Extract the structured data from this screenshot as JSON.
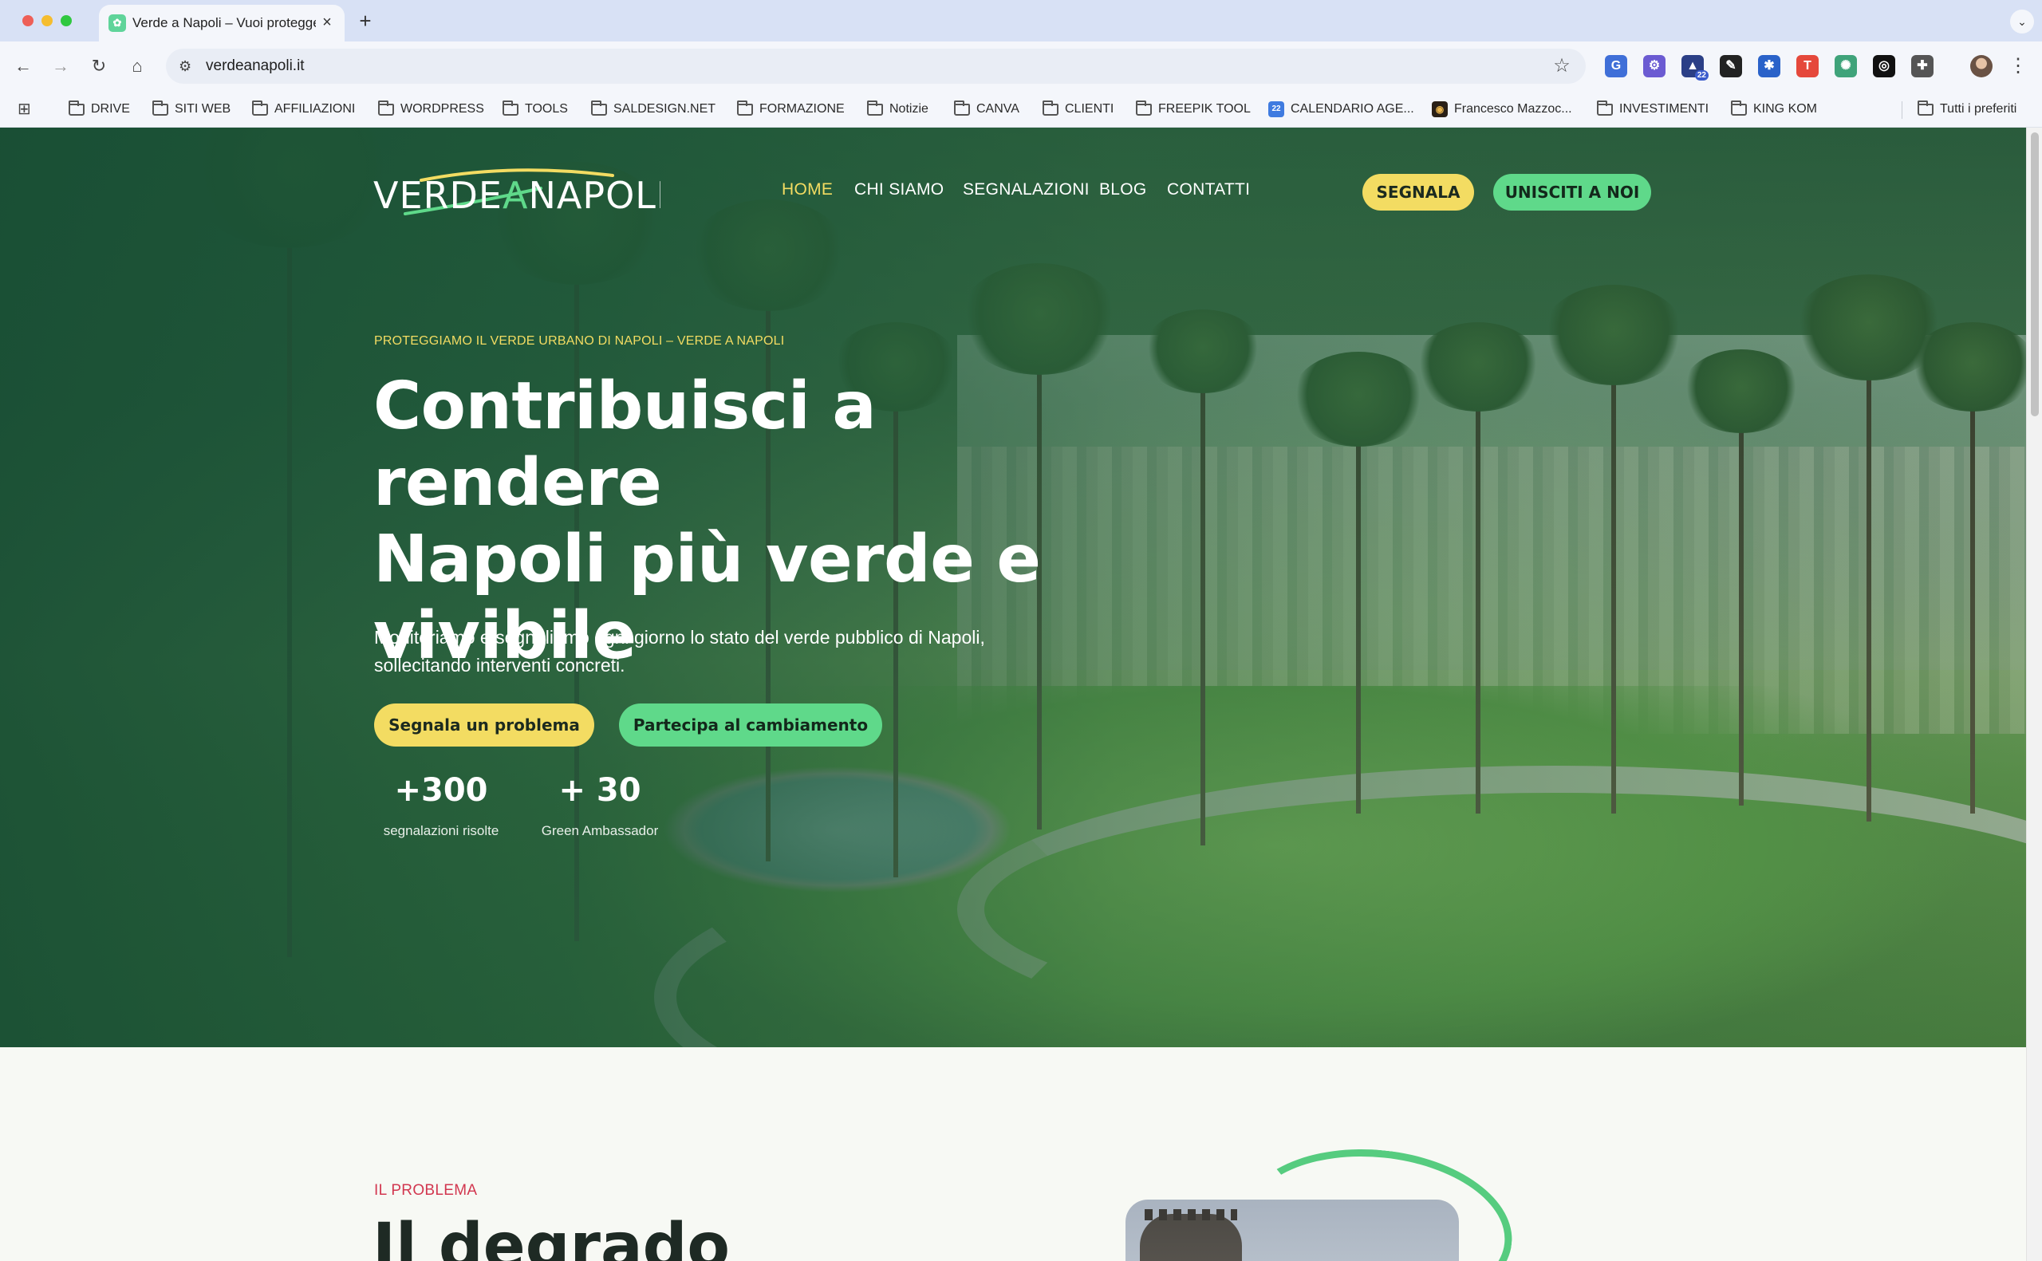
{
  "browser": {
    "tab": {
      "title": "Verde a Napoli – Vuoi proteggere",
      "favicon": "leaf-icon"
    },
    "url": "verdeanapoli.it",
    "extensions": [
      {
        "name": "translate-icon",
        "color": "#3f6fd8",
        "glyph": "G"
      },
      {
        "name": "extension-gear-icon",
        "color": "#6b5bd2",
        "glyph": "⚙"
      },
      {
        "name": "grad-cap-icon",
        "color": "#2b3f86",
        "glyph": "▲",
        "badge": "22"
      },
      {
        "name": "eyedropper-icon",
        "color": "#222222",
        "glyph": "✎"
      },
      {
        "name": "extension-blue-icon",
        "color": "#2a62c9",
        "glyph": "✱"
      },
      {
        "name": "t-extension-icon",
        "color": "#e5483b",
        "glyph": "T"
      },
      {
        "name": "chatgpt-icon",
        "color": "#3fa37a",
        "glyph": "✺"
      },
      {
        "name": "openai-icon",
        "color": "#111111",
        "glyph": "◎"
      },
      {
        "name": "puzzle-icon",
        "color": "#555555",
        "glyph": "✚"
      }
    ],
    "bookmarks": [
      {
        "label": "DRIVE",
        "type": "folder"
      },
      {
        "label": "SITI WEB",
        "type": "folder"
      },
      {
        "label": "AFFILIAZIONI",
        "type": "folder"
      },
      {
        "label": "WORDPRESS",
        "type": "folder"
      },
      {
        "label": "TOOLS",
        "type": "folder"
      },
      {
        "label": "SALDESIGN.NET",
        "type": "folder"
      },
      {
        "label": "FORMAZIONE",
        "type": "folder"
      },
      {
        "label": "Notizie",
        "type": "folder"
      },
      {
        "label": "CANVA",
        "type": "folder"
      },
      {
        "label": "CLIENTI",
        "type": "folder"
      },
      {
        "label": "FREEPIK TOOL",
        "type": "folder"
      },
      {
        "label": "CALENDARIO AGE...",
        "type": "calendar"
      },
      {
        "label": "Francesco Mazzoc...",
        "type": "site"
      },
      {
        "label": "INVESTIMENTI",
        "type": "folder"
      },
      {
        "label": "KING KOM",
        "type": "folder"
      }
    ],
    "bookmarks_other": "Tutti i preferiti"
  },
  "site": {
    "logo": {
      "left": "VERDE",
      "mid": "A",
      "right": "NAPOLI"
    },
    "nav": [
      "HOME",
      "CHI SIAMO",
      "SEGNALAZIONI",
      "BLOG",
      "CONTATTI"
    ],
    "nav_active": "HOME",
    "btn_segnala": "SEGNALA",
    "btn_unisciti": "UNISCITI A NOI",
    "accent_yellow": "#f3dc62",
    "accent_green": "#5fd98a"
  },
  "hero": {
    "eyebrow": "PROTEGGIAMO IL VERDE URBANO DI NAPOLI – VERDE A NAPOLI",
    "headline_line1": "Contribuisci a rendere",
    "headline_line2": "Napoli più verde e",
    "headline_line3": "vivibile",
    "subtitle_line1": "Monitoriamo e segnaliamo ogni giorno lo stato del verde pubblico di Napoli,",
    "subtitle_line2": "sollecitando interventi concreti.",
    "cta_primary": "Segnala un problema",
    "cta_secondary": "Partecipa al cambiamento",
    "stats": [
      {
        "value": "+300",
        "label": "segnalazioni risolte"
      },
      {
        "value": "+ 30",
        "label": "Green Ambassador"
      }
    ]
  },
  "problem": {
    "eyebrow": "IL PROBLEMA",
    "title": "Il degrado"
  }
}
